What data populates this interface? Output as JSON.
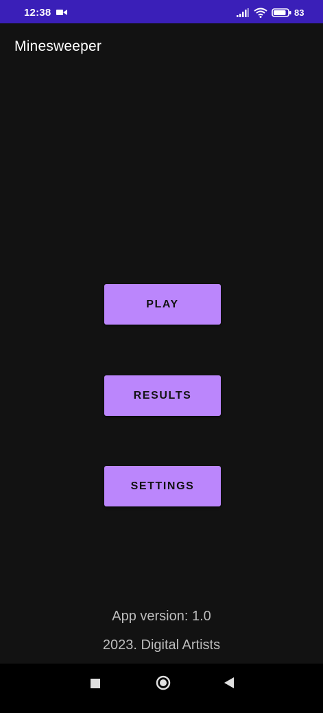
{
  "status_bar": {
    "time": "12:38",
    "battery": "83",
    "icons": [
      "video-camera-icon",
      "signal-icon",
      "wifi-icon",
      "battery-icon"
    ],
    "color": "#3a1fb8"
  },
  "app_bar": {
    "title": "Minesweeper"
  },
  "menu": {
    "play_label": "PLAY",
    "results_label": "RESULTS",
    "settings_label": "SETTINGS",
    "button_color": "#bb86fc"
  },
  "footer": {
    "version": "App version: 1.0",
    "copyright": "2023. Digital Artists"
  },
  "nav_bar": {
    "icons": [
      "recents-icon",
      "home-icon",
      "back-icon"
    ]
  },
  "theme": {
    "background": "#121212"
  }
}
